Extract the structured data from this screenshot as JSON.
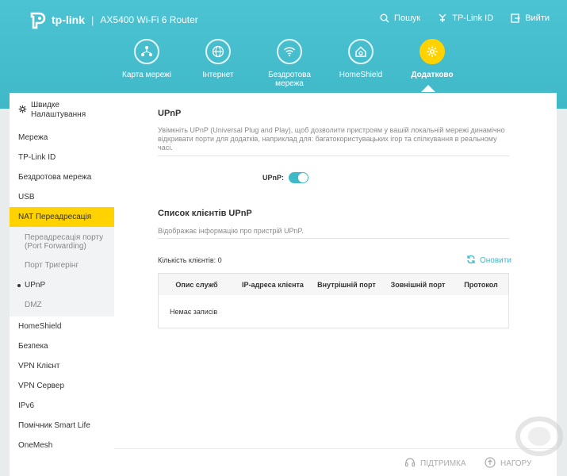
{
  "header": {
    "brand": "tp-link",
    "model": "AX5400 Wi-Fi 6 Router",
    "links": [
      {
        "label": "Пошук",
        "icon": "search-icon"
      },
      {
        "label": "TP-Link ID",
        "icon": "id-icon"
      },
      {
        "label": "Вийти",
        "icon": "logout-icon"
      }
    ]
  },
  "nav": [
    {
      "label": "Карта мережі",
      "icon": "network-map-icon"
    },
    {
      "label": "Інтернет",
      "icon": "globe-icon"
    },
    {
      "label": "Бездротова мережа",
      "icon": "wifi-icon"
    },
    {
      "label": "HomeShield",
      "icon": "home-shield-icon"
    },
    {
      "label": "Додатково",
      "icon": "gear-icon",
      "active": true
    }
  ],
  "sidebar": {
    "quick_setup": "Швидке Налаштування",
    "items_top": [
      "Мережа",
      "TP-Link ID",
      "Бездротова мережа",
      "USB"
    ],
    "active": "NAT Переадресація",
    "sub_items": [
      "Переадресація порту (Port Forwarding)",
      "Порт Тригерінг",
      "UPnP",
      "DMZ"
    ],
    "current_sub": "UPnP",
    "items_bottom": [
      "HomeShield",
      "Безпека",
      "VPN Клієнт",
      "VPN Сервер",
      "IPv6",
      "Помічник Smart Life",
      "OneMesh"
    ]
  },
  "main": {
    "upnp_title": "UPnP",
    "upnp_desc": "Увімкніть UPnP (Universal Plug and Play), щоб дозволити пристроям у вашій локальній мережі динамічно відкривати порти для додатків, наприклад для: багатокористувацьких ігор та спілкування в реальному часі.",
    "toggle_label": "UPnP:",
    "toggle_on": true,
    "clients_title": "Список клієнтів UPnP",
    "clients_desc": "Відображає інформацію про пристрій UPnP.",
    "count_label": "Кількість клієнтів: 0",
    "refresh_label": "Оновити",
    "columns": [
      "Опис служб",
      "IP-адреса клієнта",
      "Внутрішній порт",
      "Зовнішній порт",
      "Протокол"
    ],
    "empty_text": "Немає записів"
  },
  "footer": {
    "support": "ПІДТРИМКА",
    "top": "НАГОРУ"
  },
  "colors": {
    "accent": "#3fb8c8",
    "active": "#ffd200"
  }
}
